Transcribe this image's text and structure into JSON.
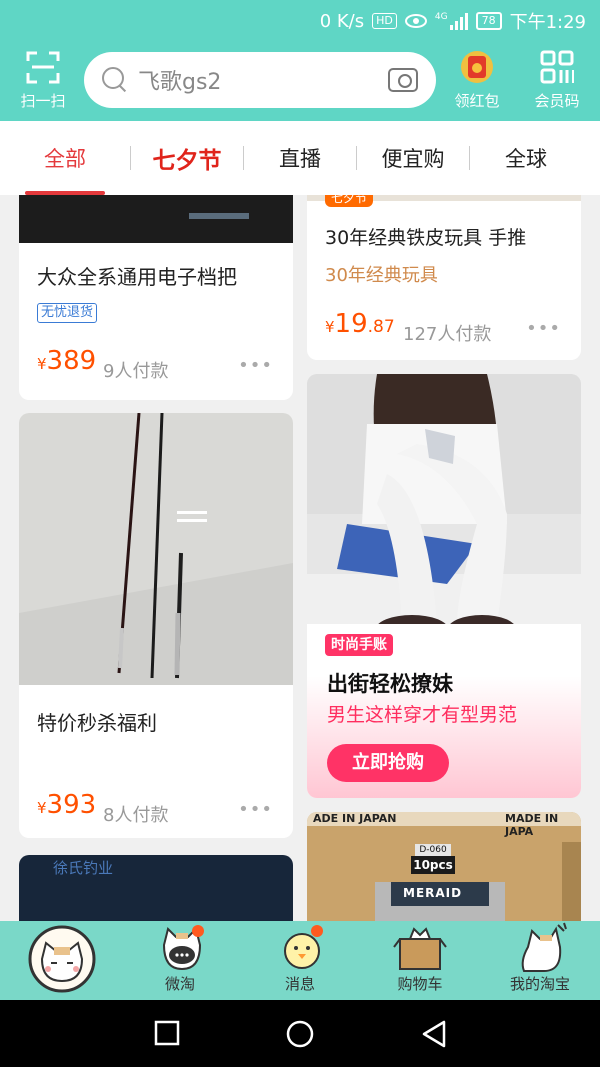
{
  "status": {
    "speed": "0 K/s",
    "hd": "HD",
    "network": "4G",
    "battery": "78",
    "time": "下午1:29"
  },
  "header": {
    "scan_label": "扫一扫",
    "search_placeholder": "飞歌gs2",
    "redpacket_label": "领红包",
    "redpacket_badge": "开",
    "member_label": "会员码"
  },
  "tabs": [
    "全部",
    "七夕节",
    "直播",
    "便宜购",
    "全球"
  ],
  "feed": {
    "left": [
      {
        "title": "大众全系通用电子档把",
        "badge": "无忧退货",
        "yen": "¥",
        "price": "389",
        "sales": "9人付款"
      },
      {
        "title": "特价秒杀福利",
        "yen": "¥",
        "price": "393",
        "sales": "8人付款"
      },
      {
        "image_text": "徐氏钓业"
      }
    ],
    "right": [
      {
        "tag": "七夕节",
        "title": "30年经典铁皮玩具 手推",
        "subtitle": "30年经典玩具",
        "yen": "¥",
        "price_int": "19",
        "price_dec": ".87",
        "sales": "127人付款"
      },
      {
        "promo_tag": "时尚手账",
        "promo_title": "出街轻松撩妹",
        "promo_subtitle": "男生这样穿才有型男范",
        "promo_button": "立即抢购"
      },
      {
        "box_line1": "ADE IN JAPAN",
        "box_line2": "MADE IN JAPA",
        "label_code": "D-060",
        "label_pcs": "10pcs",
        "bag_text": "MERAID"
      }
    ],
    "more": "•••"
  },
  "tabbar": [
    "",
    "微淘",
    "消息",
    "购物车",
    "我的淘宝"
  ],
  "colors": {
    "teal": "#5fd6c5",
    "accent": "#e4393c",
    "price": "#ff5000"
  }
}
